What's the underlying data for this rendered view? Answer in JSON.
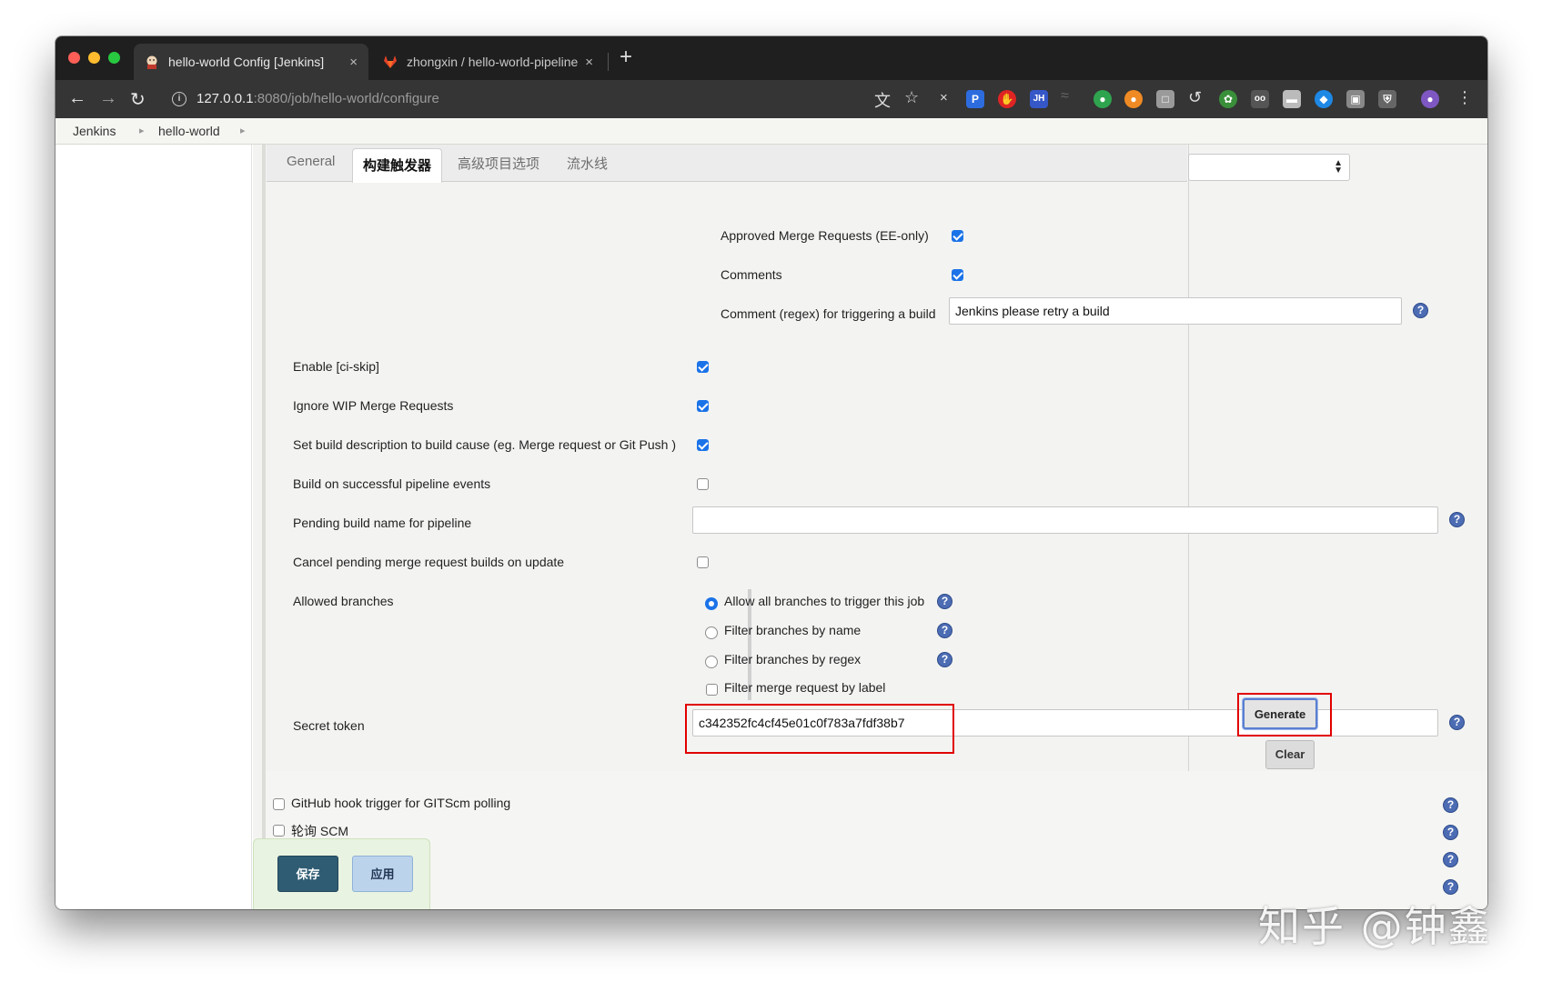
{
  "browser": {
    "tabs": [
      {
        "title": "hello-world Config [Jenkins]",
        "active": true
      },
      {
        "title": "zhongxin / hello-world-pipeline",
        "active": false
      }
    ],
    "new_tab": "+",
    "close_glyph": "×",
    "url_host": "127.0.0.1",
    "url_rest": ":8080/job/hello-world/configure"
  },
  "breadcrumb": {
    "items": [
      "Jenkins",
      "hello-world"
    ]
  },
  "config_tabs": [
    "General",
    "构建触发器",
    "高级项目选项",
    "流水线"
  ],
  "gitlab_options": {
    "approved_mr": {
      "label": "Approved Merge Requests (EE-only)",
      "checked": true
    },
    "comments": {
      "label": "Comments",
      "checked": true
    },
    "comment_regex": {
      "label": "Comment (regex) for triggering a build",
      "value": "Jenkins please retry a build"
    }
  },
  "settings": {
    "ci_skip": {
      "label": "Enable [ci-skip]",
      "checked": true
    },
    "ignore_wip": {
      "label": "Ignore WIP Merge Requests",
      "checked": true
    },
    "set_desc": {
      "label": "Set build description to build cause (eg. Merge request or Git Push )",
      "checked": true
    },
    "pipeline_events": {
      "label": "Build on successful pipeline events",
      "checked": false
    },
    "pending_name": {
      "label": "Pending build name for pipeline",
      "value": ""
    },
    "cancel_pending": {
      "label": "Cancel pending merge request builds on update",
      "checked": false
    },
    "allowed_branches": {
      "label": "Allowed branches",
      "options": [
        {
          "label": "Allow all branches to trigger this job",
          "selected": true
        },
        {
          "label": "Filter branches by name",
          "selected": false
        },
        {
          "label": "Filter branches by regex",
          "selected": false
        }
      ],
      "label_filter": {
        "label": "Filter merge request by label",
        "checked": false
      }
    },
    "secret_token": {
      "label": "Secret token",
      "value": "c342352fc4cf45e01c0f783a7fdf38b7"
    },
    "generate_button": "Generate",
    "clear_button": "Clear"
  },
  "triggers": {
    "github_hook": {
      "label": "GitHub hook trigger for GITScm polling",
      "checked": false
    },
    "poll_scm": {
      "label": "轮询 SCM",
      "checked": false
    }
  },
  "actions": {
    "save": "保存",
    "apply": "应用"
  },
  "help_glyph": "?",
  "watermark": "知乎 @钟鑫",
  "colors": {
    "checkbox_checked": "#1b73e8",
    "help_icon": "#4c6cb3",
    "highlight_box": "#e10000",
    "save_button": "#2f5c72",
    "apply_button": "#bcd3ec",
    "browser_chrome": "#353535"
  }
}
